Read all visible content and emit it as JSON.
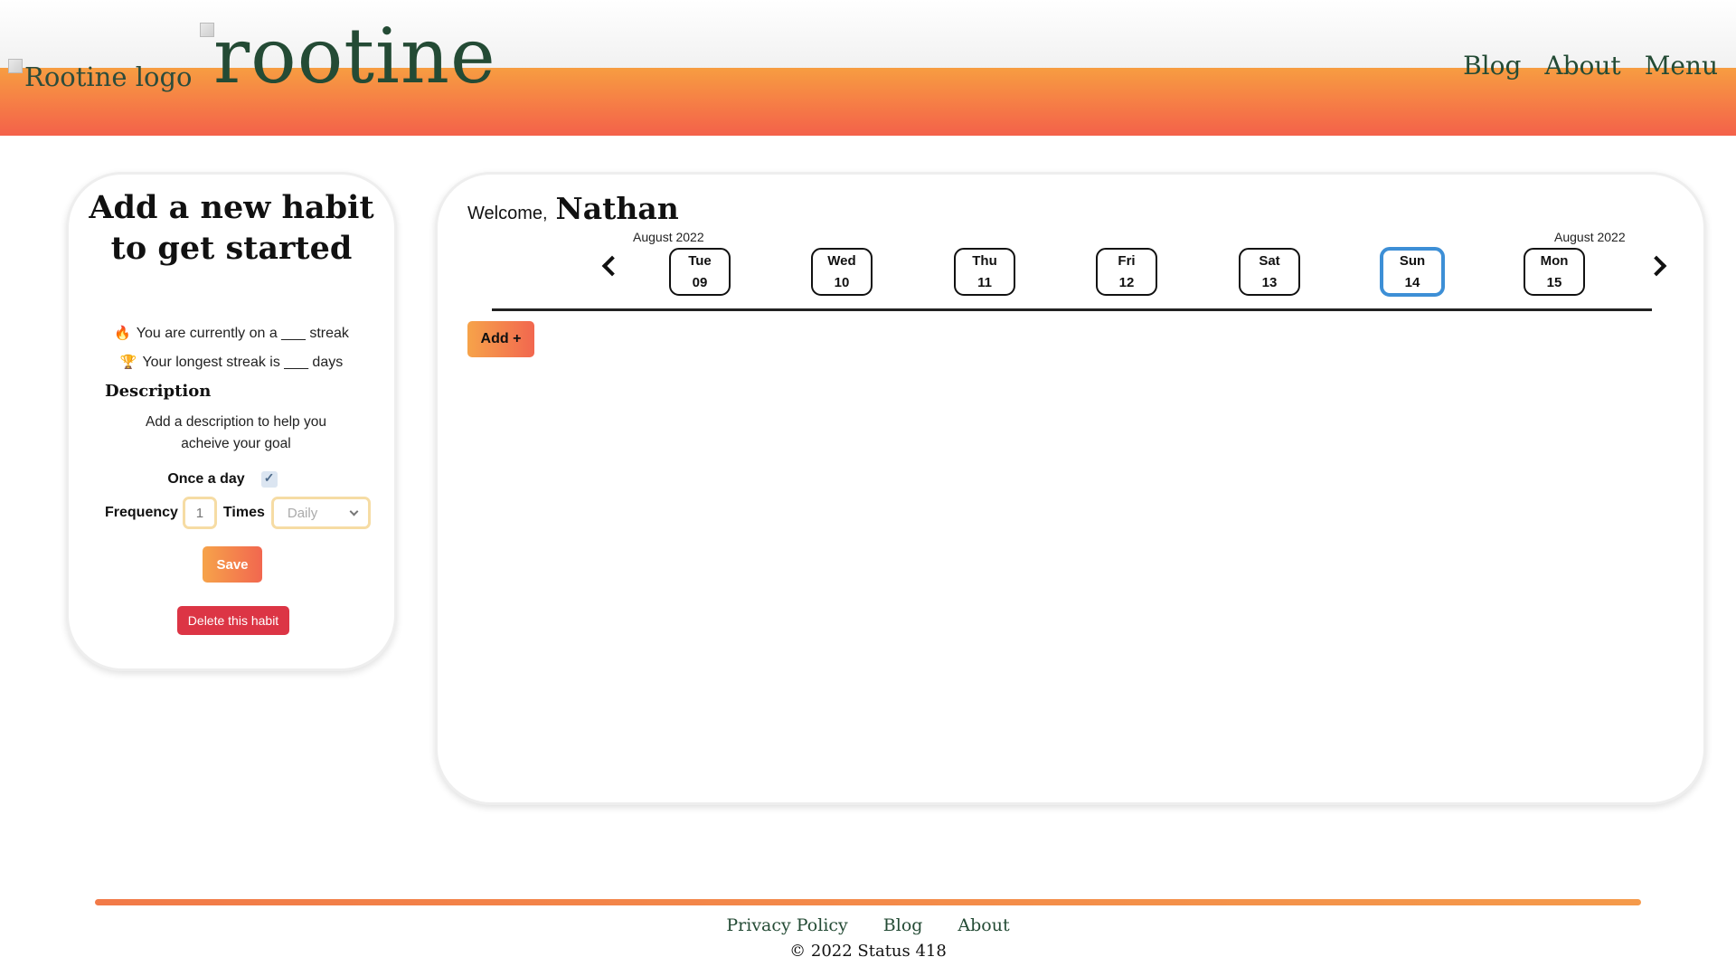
{
  "header": {
    "logo_alt": "Rootine logo",
    "brand": "rootine",
    "nav": {
      "blog": "Blog",
      "about": "About",
      "menu": "Menu"
    }
  },
  "habit_form": {
    "title": "Add a new habit to get started",
    "streak_text": "You are currently on a ___ streak",
    "longest_text": "Your longest streak is ___ days",
    "description_heading": "Description",
    "description_text": "Add a description to help you acheive your goal",
    "once_label": "Once a day",
    "once_checked": true,
    "frequency_label": "Frequency",
    "frequency_placeholder": "1",
    "times_label": "Times",
    "period_value": "Daily",
    "save_label": "Save",
    "delete_label": "Delete this habit"
  },
  "main": {
    "welcome_label": "Welcome,",
    "user_name": "Nathan",
    "month_left": "August 2022",
    "month_right": "August 2022",
    "days": [
      {
        "weekday": "Tue",
        "date": "09",
        "selected": false
      },
      {
        "weekday": "Wed",
        "date": "10",
        "selected": false
      },
      {
        "weekday": "Thu",
        "date": "11",
        "selected": false
      },
      {
        "weekday": "Fri",
        "date": "12",
        "selected": false
      },
      {
        "weekday": "Sat",
        "date": "13",
        "selected": false
      },
      {
        "weekday": "Sun",
        "date": "14",
        "selected": true
      },
      {
        "weekday": "Mon",
        "date": "15",
        "selected": false
      }
    ],
    "add_label": "Add +"
  },
  "footer": {
    "links": {
      "privacy": "Privacy Policy",
      "blog": "Blog",
      "about": "About"
    },
    "copyright": "© 2022 Status 418"
  },
  "colors": {
    "brand_green": "#244b35",
    "accent_orange": "#f79d41",
    "accent_red": "#f4614a",
    "selected_blue": "#3d8fd6",
    "danger": "#dc3545"
  }
}
